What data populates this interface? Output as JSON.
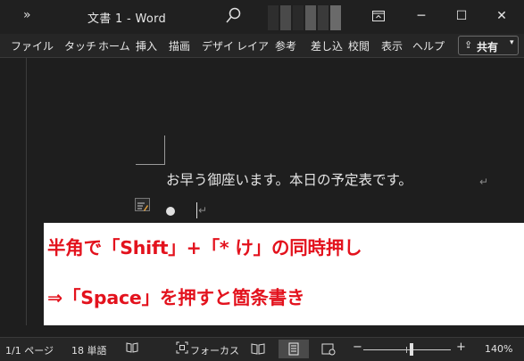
{
  "titlebar": {
    "qat": "»",
    "title": "文書 1  -  Word",
    "minimize": "─",
    "restore": "☐",
    "close": "✕"
  },
  "ribbon": {
    "tabs": [
      "ファイル",
      "タッチ",
      "ホーム",
      "挿入",
      "描画",
      "デザイ",
      "レイア",
      "参考",
      "差し込",
      "校閲",
      "表示",
      "ヘルプ"
    ],
    "share_label": "共有"
  },
  "document": {
    "line1": "お早う御座います。本日の予定表です。",
    "para_mark": "↵"
  },
  "callout": {
    "line1": "半角で「Shift」+「* け」の同時押し",
    "line2": "⇒「Space」を押すと箇条書き"
  },
  "status": {
    "page": "1/1 ページ",
    "words": "18 単語",
    "focus": "フォーカス",
    "zoom_minus": "−",
    "zoom_plus": "+",
    "zoom_level": "140%"
  },
  "colors": {
    "accent": "#e3121d",
    "background": "#1e1e1e"
  }
}
